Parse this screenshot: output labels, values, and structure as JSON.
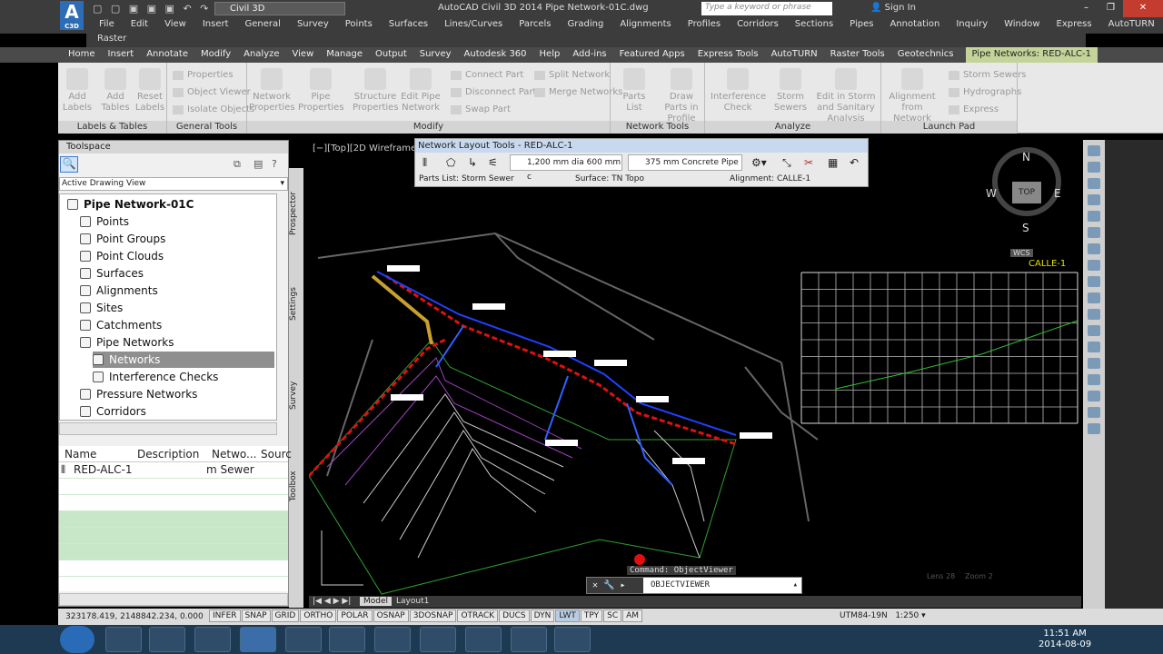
{
  "title": {
    "workspace": "Civil 3D",
    "app_title": "AutoCAD Civil 3D 2014    Pipe Network-01C.dwg",
    "search_placeholder": "Type a keyword or phrase",
    "sign_in": "Sign In",
    "logo_text": "C3D"
  },
  "menu": [
    "File",
    "Edit",
    "View",
    "Insert",
    "General",
    "Survey",
    "Points",
    "Surfaces",
    "Lines/Curves",
    "Parcels",
    "Grading",
    "Alignments",
    "Profiles",
    "Corridors",
    "Sections",
    "Pipes",
    "Annotation",
    "Inquiry",
    "Window",
    "Express",
    "AutoTURN"
  ],
  "raster_label": "Raster",
  "tabs": [
    "Home",
    "Insert",
    "Annotate",
    "Modify",
    "Analyze",
    "View",
    "Manage",
    "Output",
    "Survey",
    "Autodesk 360",
    "Help",
    "Add-ins",
    "Featured Apps",
    "Express Tools",
    "AutoTURN",
    "Raster Tools",
    "Geotechnics"
  ],
  "context_tab": "Pipe Networks: RED-ALC-1",
  "ribbon": {
    "labels_tables": {
      "title": "Labels & Tables",
      "add_labels": "Add Labels",
      "add_tables": "Add Tables",
      "reset_labels": "Reset Labels"
    },
    "general_tools": {
      "title": "General Tools",
      "properties": "Properties",
      "object_viewer": "Object Viewer",
      "isolate_objects": "Isolate Objects"
    },
    "modify": {
      "title": "Modify",
      "network_properties": "Network Properties",
      "pipe_properties": "Pipe Properties",
      "structure_properties": "Structure Properties",
      "edit_pipe_network": "Edit Pipe Network",
      "connect_part": "Connect Part",
      "disconnect_part": "Disconnect Part",
      "swap_part": "Swap Part",
      "split_network": "Split Network",
      "merge_networks": "Merge Networks"
    },
    "network_tools": {
      "title": "Network Tools",
      "parts_list": "Parts List",
      "draw_parts_in_profile": "Draw Parts in Profile"
    },
    "analyze": {
      "title": "Analyze",
      "interference_check": "Interference Check",
      "storm_sewers": "Storm Sewers",
      "edit_storm": "Edit in Storm and Sanitary Analysis"
    },
    "launch_pad": {
      "title": "Launch Pad",
      "alignment_from_network": "Alignment from Network",
      "storm_sewers": "Storm Sewers",
      "hydrographs": "Hydrographs",
      "express": "Express"
    }
  },
  "toolspace": {
    "title": "Toolspace",
    "view_select": "Active Drawing View",
    "root": "Pipe Network-01C",
    "items": [
      {
        "label": "Points",
        "level": 1
      },
      {
        "label": "Point Groups",
        "level": 1
      },
      {
        "label": "Point Clouds",
        "level": 1
      },
      {
        "label": "Surfaces",
        "level": 1
      },
      {
        "label": "Alignments",
        "level": 1
      },
      {
        "label": "Sites",
        "level": 1
      },
      {
        "label": "Catchments",
        "level": 1
      },
      {
        "label": "Pipe Networks",
        "level": 1
      },
      {
        "label": "Networks",
        "level": 2
      },
      {
        "label": "Interference Checks",
        "level": 2
      },
      {
        "label": "Pressure Networks",
        "level": 1
      },
      {
        "label": "Corridors",
        "level": 1
      }
    ],
    "vtabs": [
      "Prospector",
      "Settings",
      "Survey",
      "Toolbox"
    ],
    "list_headers": [
      "Name",
      "Description",
      "Netwo...",
      "Sourc"
    ],
    "list_row": {
      "name": "RED-ALC-1",
      "network": "m Sewer"
    }
  },
  "viewport": {
    "label": "[−][Top][2D Wireframe]",
    "viewcube_top": "TOP",
    "compass": {
      "n": "N",
      "s": "S",
      "e": "E",
      "w": "W"
    },
    "wcs": "WCS",
    "profile_label": "CALLE-1",
    "zoom_info_1": "Lens 28",
    "zoom_info_2": "Zoom 2"
  },
  "network_layout_tools": {
    "title": "Network Layout Tools - RED-ALC-1",
    "structure": "1,200 mm dia 600 mm c",
    "pipe": "375 mm Concrete Pipe",
    "parts_list": "Parts List: Storm Sewer",
    "surface": "Surface: TN Topo",
    "alignment": "Alignment: CALLE-1"
  },
  "command": {
    "last": "Command: ObjectViewer",
    "current": "OBJECTVIEWER"
  },
  "layout_tabs": [
    "Model",
    "Layout1"
  ],
  "status": {
    "coords": "323178.419, 2148842.234, 0.000",
    "toggles": [
      "INFER",
      "SNAP",
      "GRID",
      "ORTHO",
      "POLAR",
      "OSNAP",
      "3DOSNAP",
      "OTRACK",
      "DUCS",
      "DYN",
      "LWT",
      "TPY",
      "SC",
      "AM"
    ],
    "active_toggle": "LWT",
    "coordsys": "UTM84-19N",
    "scale": "1:250"
  },
  "taskbar": {
    "time": "11:51 AM",
    "date": "2014-08-09"
  },
  "colors": {
    "accent": "#2d6db5",
    "context_tab": "#c4d39a",
    "pipe_red": "#e01010",
    "pipe_blue": "#2040ff"
  }
}
